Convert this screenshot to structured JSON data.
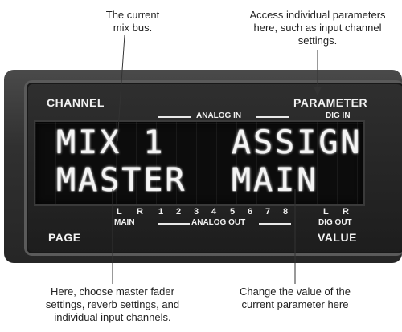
{
  "callouts": {
    "mix_bus": "The current\nmix bus.",
    "access_params": "Access individual parameters\nhere, such as input channel\nsettings.",
    "master_fader": "Here, choose master fader\nsettings, reverb settings, and\nindividual input channels.",
    "change_value": "Change the value of the\ncurrent parameter here"
  },
  "panel": {
    "channel": "CHANNEL",
    "parameter": "PARAMETER",
    "analog_in": "ANALOG IN",
    "dig_in": "DIG IN",
    "page": "PAGE",
    "value": "VALUE",
    "main": "MAIN",
    "analog_out": "ANALOG OUT",
    "dig_out": "DIG OUT",
    "meter_labels": [
      "L",
      "R",
      "1",
      "2",
      "3",
      "4",
      "5",
      "6",
      "7",
      "8",
      "L",
      "R"
    ]
  },
  "lcd": {
    "line1_left": "MIX 1",
    "line1_right": "ASSIGN",
    "line2_left": "MASTER",
    "line2_right": "MAIN"
  },
  "colors": {
    "panel": "#2a2a2a",
    "lcd_background": "#0c0c0c",
    "lcd_text": "#f4f4f4",
    "leader_line": "#333333"
  }
}
